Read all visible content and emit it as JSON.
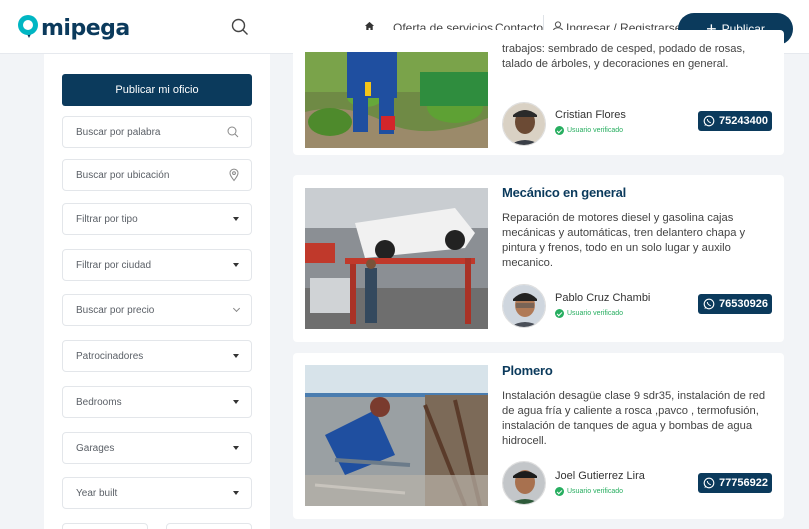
{
  "header": {
    "logo_text": "mipega",
    "nav": {
      "services": "Oferta de servicios",
      "contact": "Contacto",
      "login": "Ingresar / Registrarse"
    },
    "publish_label": "Publicar"
  },
  "sidebar": {
    "publish_button": "Publicar mi oficio",
    "search_word_placeholder": "Buscar por palabra",
    "search_location_placeholder": "Buscar por ubicación",
    "filter_type": "Filtrar por tipo",
    "filter_city": "Filtrar por ciudad",
    "search_price": "Buscar por precio",
    "sponsors": "Patrocinadores",
    "bedrooms": "Bedrooms",
    "garages": "Garages",
    "year_built": "Year built"
  },
  "listings": [
    {
      "title": "",
      "description": "trabajos: sembrado de cesped, podado de rosas, talado de árboles, y decoraciones en general.",
      "user_name": "Cristian Flores",
      "verified_label": "Usuario verificado",
      "phone": "75243400"
    },
    {
      "title": "Mecánico en general",
      "description": "Reparación de motores diesel y gasolina cajas mecánicas y automáticas, tren delantero chapa y pintura y frenos, todo en un solo lugar y auxilo mecanico.",
      "user_name": "Pablo Cruz Chambi",
      "verified_label": "Usuario verificado",
      "phone": "76530926"
    },
    {
      "title": "Plomero",
      "description": "Instalación desagüe clase 9 sdr35, instalación de red de agua fría y caliente a rosca ,pavco , termofusión, instalación de tanques de agua y bombas de agua hidrocell.",
      "user_name": "Joel Gutierrez Lira",
      "verified_label": "Usuario verificado",
      "phone": "77756922"
    }
  ],
  "colors": {
    "brand_dark": "#0b3a5c",
    "brand_teal": "#00b6c3",
    "verified_green": "#27ae60"
  },
  "icons": [
    "search-icon",
    "home-icon",
    "user-icon",
    "plus-icon",
    "location-pin-icon",
    "whatsapp-icon",
    "check-icon",
    "caret-down-icon"
  ]
}
